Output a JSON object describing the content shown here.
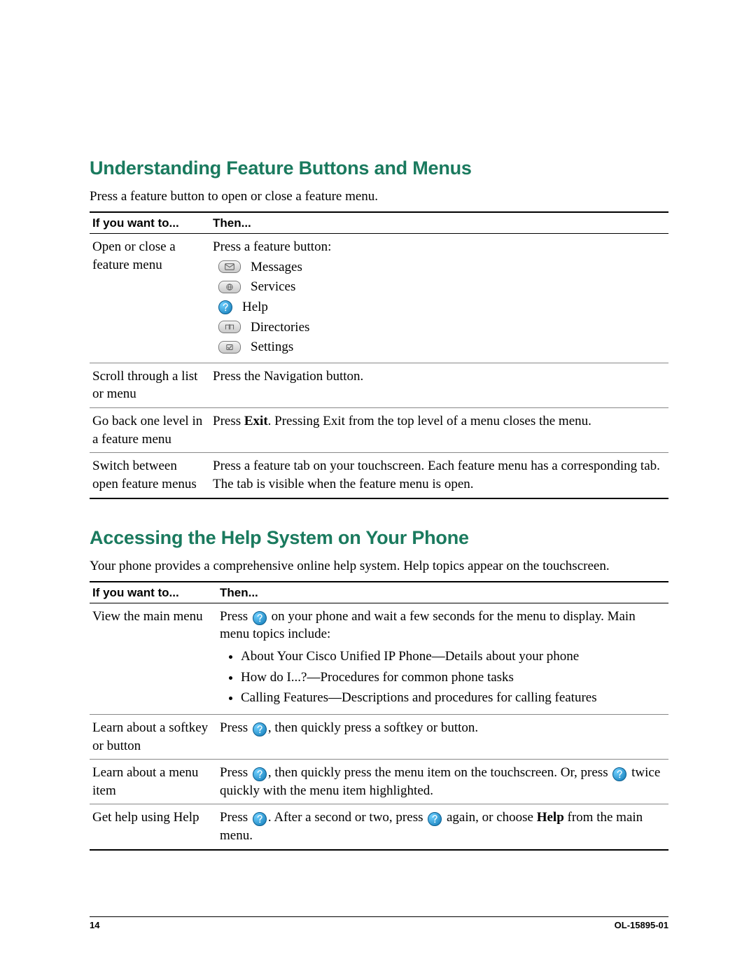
{
  "section1": {
    "heading": "Understanding Feature Buttons and Menus",
    "intro": "Press a feature button to open or close a feature menu.",
    "th1": "If you want to...",
    "th2": "Then...",
    "rows": [
      {
        "want": "Open or close a feature menu",
        "then_lead": "Press a feature button:",
        "buttons": [
          "Messages",
          "Services",
          "Help",
          "Directories",
          "Settings"
        ]
      },
      {
        "want": "Scroll through a list or menu",
        "then": "Press the Navigation button."
      },
      {
        "want": "Go back one level in a feature menu",
        "then_pre": "Press ",
        "then_bold": "Exit",
        "then_post": ". Pressing Exit from the top level of a menu closes the menu."
      },
      {
        "want": "Switch between open feature menus",
        "then": "Press a feature tab on your touchscreen. Each feature menu has a corresponding tab. The tab is visible when the feature menu is open."
      }
    ]
  },
  "section2": {
    "heading": "Accessing the Help System on Your Phone",
    "intro": "Your phone provides a comprehensive online help system. Help topics appear on the touchscreen.",
    "th1": "If you want to...",
    "th2": "Then...",
    "rows": [
      {
        "want": "View the main menu",
        "then_pre": "Press ",
        "then_post": " on your phone and wait a few seconds for the menu to display. Main menu topics include:",
        "topics": [
          "About Your Cisco Unified IP Phone—Details about your phone",
          "How do I...?—Procedures for common phone tasks",
          "Calling Features—Descriptions and procedures for calling features"
        ]
      },
      {
        "want": "Learn about a softkey or button",
        "then_pre": "Press ",
        "then_post": ", then quickly press a softkey or button."
      },
      {
        "want": "Learn about a menu item",
        "then_pre": "Press ",
        "then_mid": ", then quickly press the menu item on the touchscreen. Or, press ",
        "then_post": " twice quickly with the menu item highlighted."
      },
      {
        "want": "Get help using Help",
        "then_pre": "Press ",
        "then_mid": ". After a second or two, press ",
        "then_post1": " again, or choose ",
        "then_bold": "Help",
        "then_post2": " from the main menu."
      }
    ]
  },
  "footer": {
    "page": "14",
    "docid": "OL-15895-01"
  }
}
